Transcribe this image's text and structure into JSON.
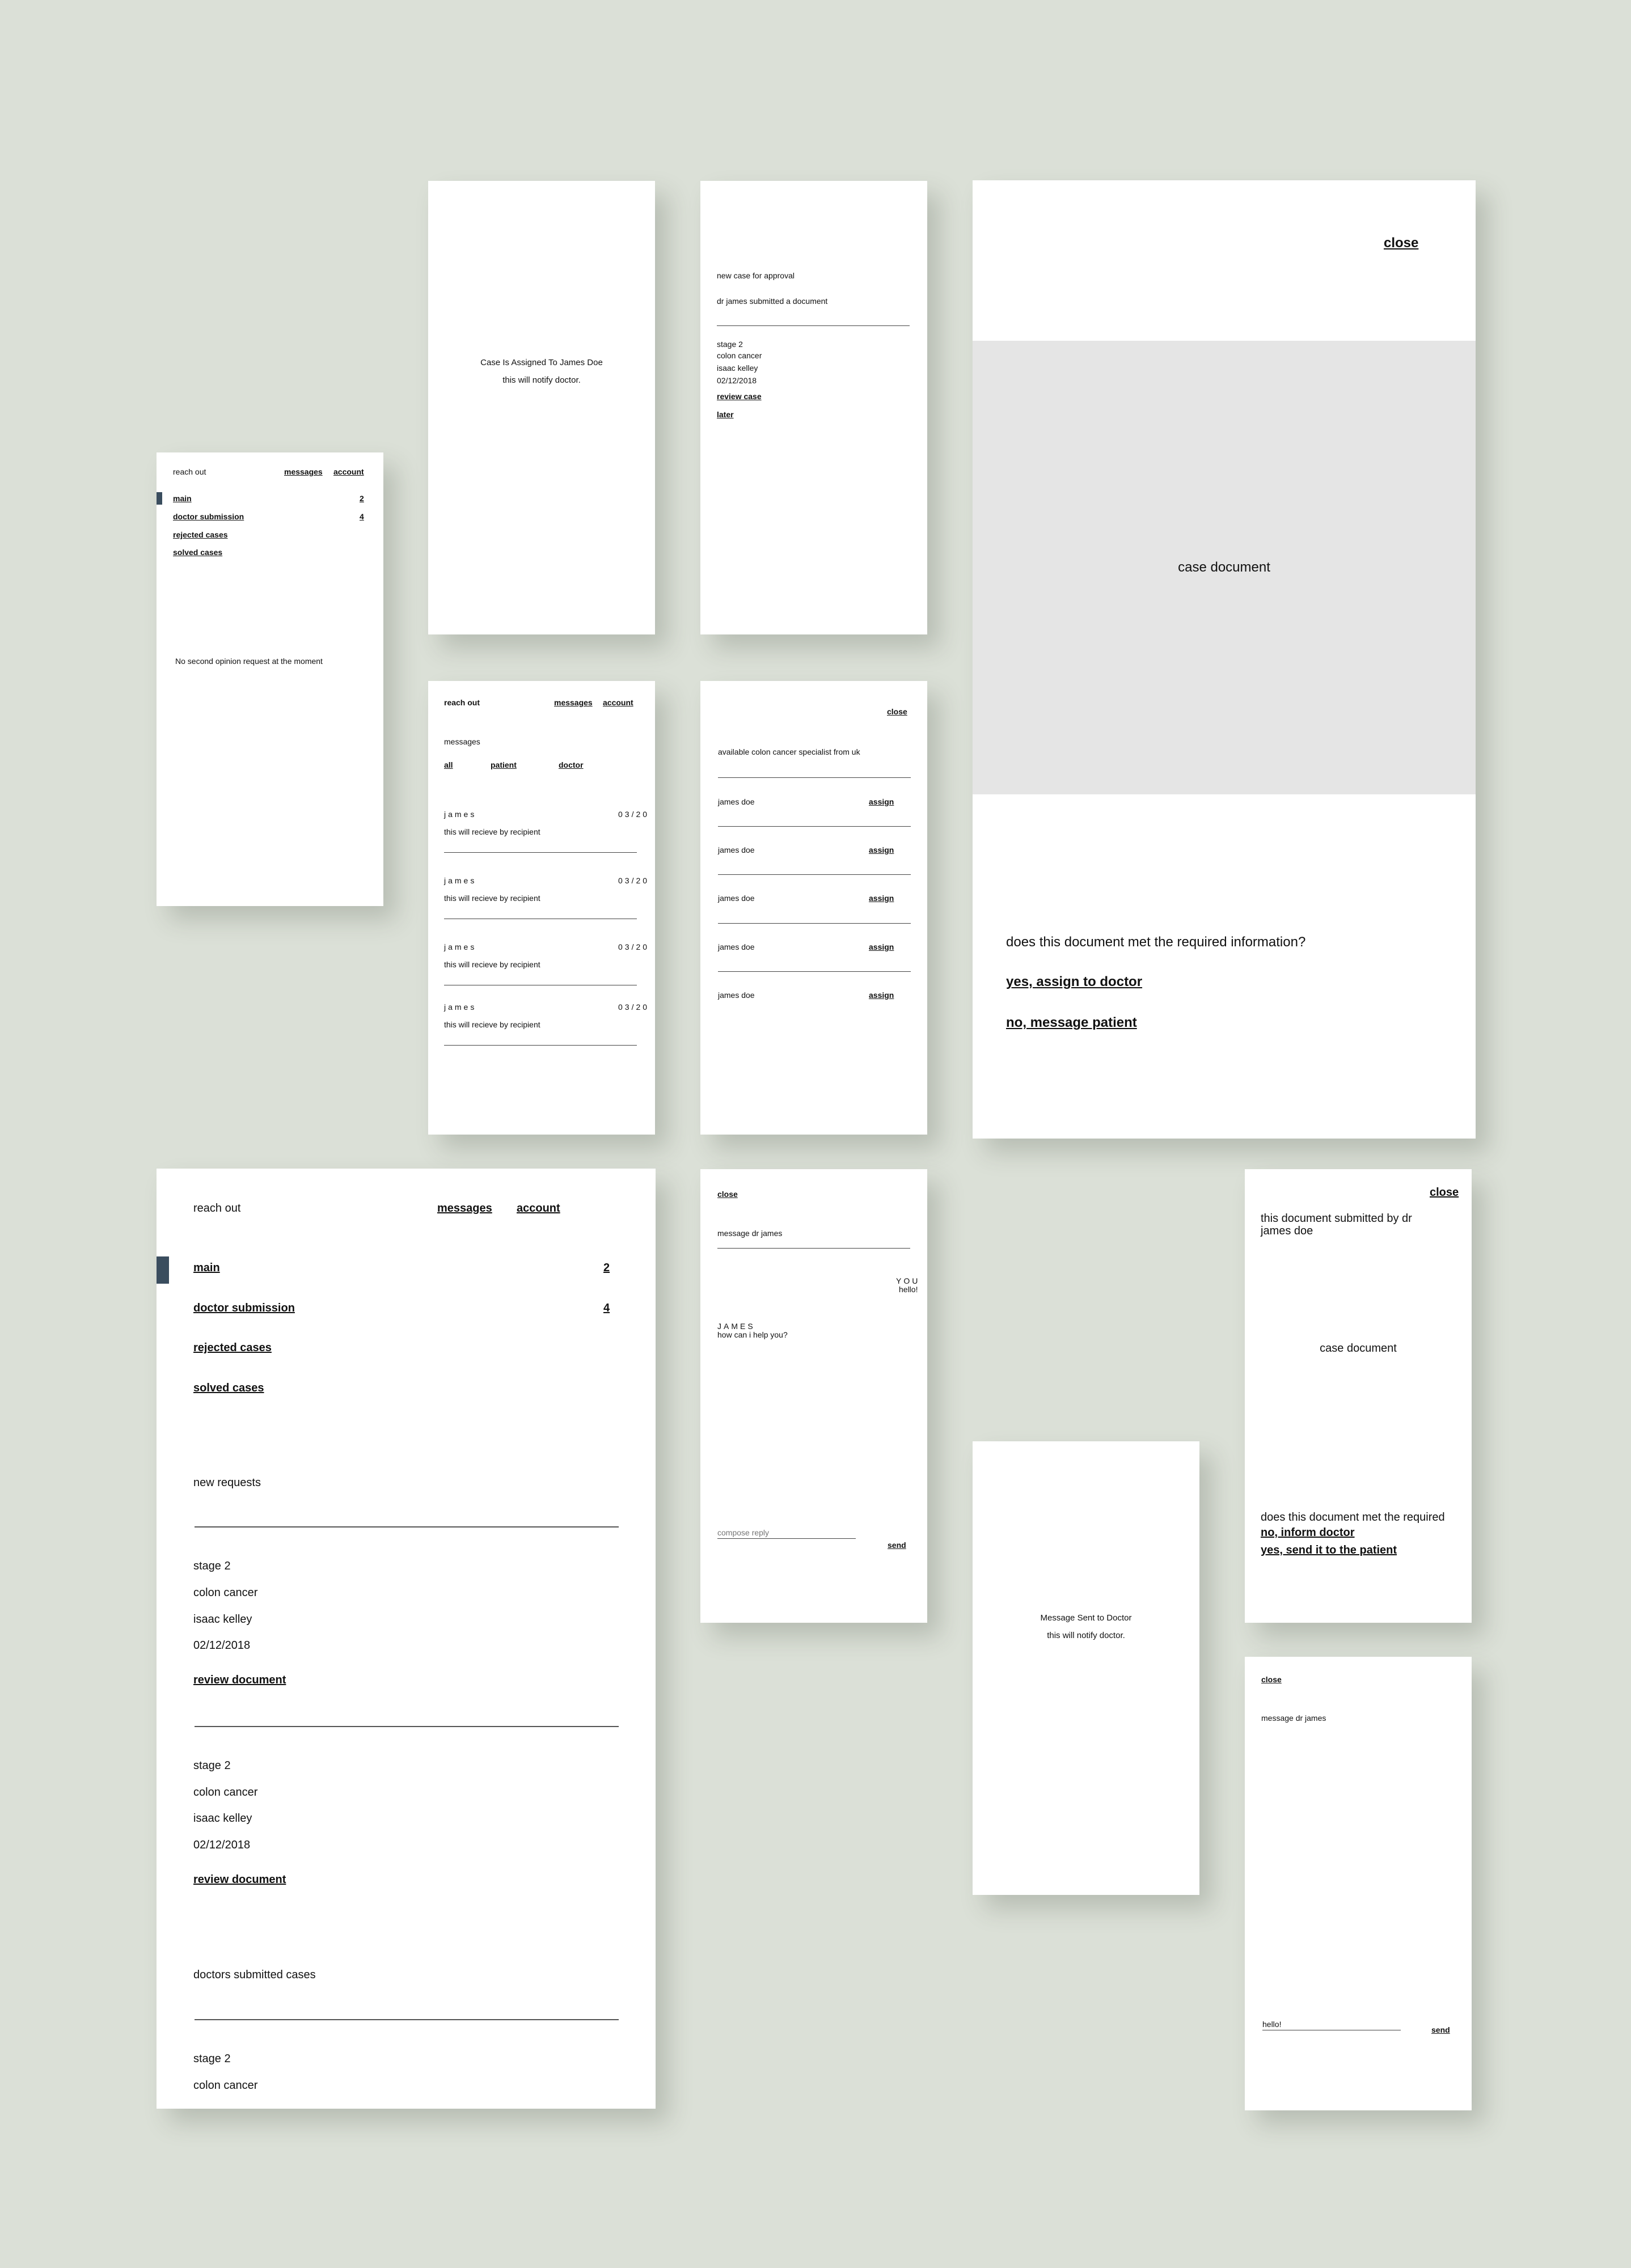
{
  "colors": {
    "background": "#dbe0d7",
    "marker": "#3a4d5e",
    "document_placeholder": "#e5e5e5"
  },
  "dashboard_small": {
    "brand": "reach out",
    "nav_messages": "messages",
    "nav_account": "account",
    "menu": [
      {
        "label": "main",
        "count": "2"
      },
      {
        "label": "doctor submission",
        "count": "4"
      },
      {
        "label": "rejected cases",
        "count": ""
      },
      {
        "label": "solved cases",
        "count": ""
      }
    ],
    "empty_state": "No second opinion request at the moment"
  },
  "assigned_confirm": {
    "title": "Case Is Assigned To James Doe",
    "subtitle": "this will notify doctor."
  },
  "approval_card": {
    "heading": "new case for approval",
    "submitted": "dr james submitted a document",
    "details": [
      "stage 2",
      "colon cancer",
      "isaac kelley",
      "02/12/2018"
    ],
    "review": "review case",
    "later": "later"
  },
  "document_large": {
    "close": "close",
    "doc_label": "case document",
    "question": "does this document met the  required information?",
    "yes": "yes, assign to doctor",
    "no": "no, message patient"
  },
  "messages_card": {
    "brand": "reach out",
    "nav_messages": "messages",
    "nav_account": "account",
    "section": "messages",
    "tabs": [
      "all",
      "patient",
      "doctor"
    ],
    "items": [
      {
        "name": "james",
        "date": "03/20",
        "preview": "this will recieve by recipient"
      },
      {
        "name": "james",
        "date": "03/20",
        "preview": "this will recieve by recipient"
      },
      {
        "name": "james",
        "date": "03/20",
        "preview": "this will recieve by recipient"
      },
      {
        "name": "james",
        "date": "03/20",
        "preview": "this will recieve by recipient"
      }
    ]
  },
  "specialists_card": {
    "close": "close",
    "heading": "available colon cancer specialist from uk",
    "rows": [
      {
        "name": "james doe",
        "action": "assign"
      },
      {
        "name": "james doe",
        "action": "assign"
      },
      {
        "name": "james doe",
        "action": "assign"
      },
      {
        "name": "james doe",
        "action": "assign"
      },
      {
        "name": "james doe",
        "action": "assign"
      }
    ]
  },
  "dashboard_large": {
    "brand": "reach out",
    "nav_messages": "messages",
    "nav_account": "account",
    "menu": [
      {
        "label": "main",
        "count": "2"
      },
      {
        "label": "doctor submission",
        "count": "4"
      },
      {
        "label": "rejected cases",
        "count": ""
      },
      {
        "label": "solved cases",
        "count": ""
      }
    ],
    "new_requests_heading": "new requests",
    "requests": [
      {
        "stage": "stage 2",
        "disease": "colon cancer",
        "patient": "isaac kelley",
        "date": "02/12/2018",
        "action": "review document"
      },
      {
        "stage": "stage 2",
        "disease": "colon cancer",
        "patient": "isaac kelley",
        "date": "02/12/2018",
        "action": "review document"
      }
    ],
    "doctors_heading": "doctors submitted cases",
    "doctor_cases": [
      {
        "stage": "stage 2",
        "disease": "colon cancer"
      }
    ]
  },
  "chat_card": {
    "close": "close",
    "heading": "message dr james",
    "you_label": "YOU",
    "you_text": "hello!",
    "james_label": "JAMES",
    "james_text": "how can i help you?",
    "compose_placeholder": "compose reply",
    "send": "send"
  },
  "sent_confirm": {
    "title": "Message Sent to Doctor",
    "subtitle": "this will notify doctor."
  },
  "doctor_doc_card": {
    "close": "close",
    "submitted": "this document submitted by dr james doe",
    "doc_label": "case document",
    "question": "does this document met the  required",
    "no": "no, inform doctor",
    "yes": "yes, send it to the patient"
  },
  "compose_card": {
    "close": "close",
    "heading": "message dr james",
    "input_value": "hello!",
    "send": "send"
  }
}
